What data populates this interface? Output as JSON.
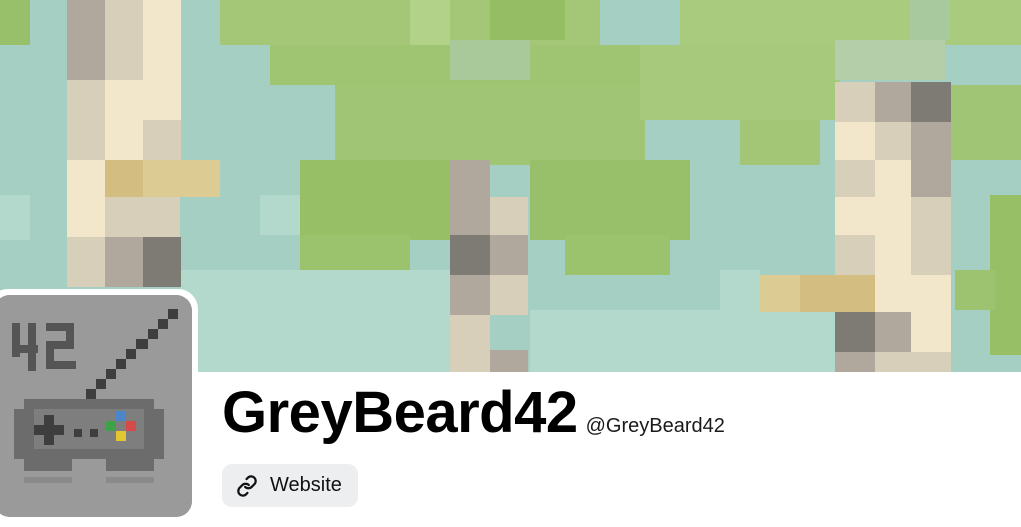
{
  "profile": {
    "display_name": "GreyBeard42",
    "handle": "@GreyBeard42",
    "website_label": "Website",
    "avatar_text": "42"
  },
  "icons": {
    "website": "link-icon",
    "avatar": "gamepad-icon"
  },
  "colors": {
    "text": "#000000",
    "button_bg": "#eceef0",
    "avatar_bg": "#9a9a9a"
  }
}
